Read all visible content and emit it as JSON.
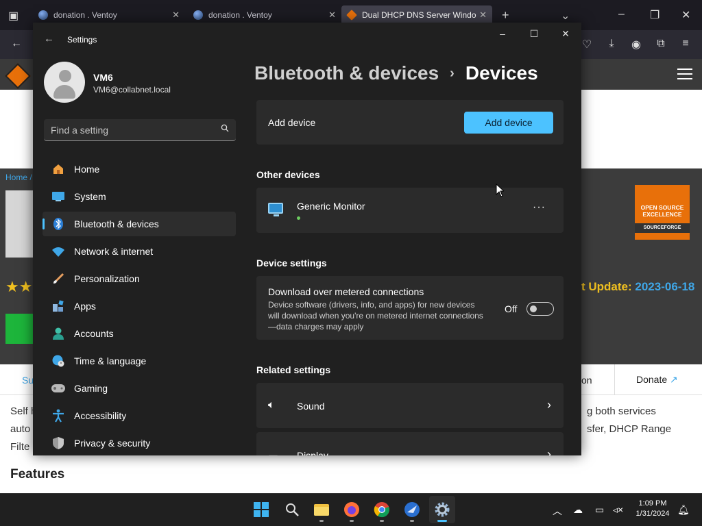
{
  "browser": {
    "tabs": [
      {
        "title": "donation . Ventoy"
      },
      {
        "title": "donation . Ventoy"
      },
      {
        "title": "Dual DHCP DNS Server Windo"
      }
    ],
    "new_tab_symbol": "+"
  },
  "webpage": {
    "breadcrumb": "Home /",
    "badge": {
      "line1": "OPEN SOURCE",
      "line2": "EXCELLENCE",
      "line3": "SOURCEFORGE"
    },
    "last_update_label": "t Update: ",
    "last_update_date": "2023-06-18",
    "tab_left": "Su",
    "tab_mid": "on",
    "donate": "Donate",
    "para_left": [
      "Self h",
      "auto",
      "Filte"
    ],
    "para_right": [
      "g both services",
      "sfer, DHCP Range"
    ],
    "features": "Features"
  },
  "settings": {
    "window_title": "Settings",
    "user": {
      "name": "VM6",
      "email": "VM6@collabnet.local"
    },
    "search_placeholder": "Find a setting",
    "nav": [
      {
        "label": "Home",
        "icon": "home-icon"
      },
      {
        "label": "System",
        "icon": "system-icon"
      },
      {
        "label": "Bluetooth & devices",
        "icon": "bluetooth-icon",
        "selected": true
      },
      {
        "label": "Network & internet",
        "icon": "wifi-icon"
      },
      {
        "label": "Personalization",
        "icon": "brush-icon"
      },
      {
        "label": "Apps",
        "icon": "apps-icon"
      },
      {
        "label": "Accounts",
        "icon": "accounts-icon"
      },
      {
        "label": "Time & language",
        "icon": "globe-clock-icon"
      },
      {
        "label": "Gaming",
        "icon": "gamepad-icon"
      },
      {
        "label": "Accessibility",
        "icon": "accessibility-icon"
      },
      {
        "label": "Privacy & security",
        "icon": "shield-icon"
      }
    ],
    "breadcrumb_parent": "Bluetooth & devices",
    "breadcrumb_sep": "›",
    "breadcrumb_current": "Devices",
    "add_device": {
      "label": "Add device",
      "button": "Add device"
    },
    "other_devices_heading": "Other devices",
    "device": {
      "name": "Generic Monitor",
      "more": "···"
    },
    "device_settings_heading": "Device settings",
    "metered": {
      "title": "Download over metered connections",
      "description": "Device software (drivers, info, and apps) for new devices will download when you're on metered internet connections—data charges may apply",
      "state_label": "Off",
      "enabled": false
    },
    "related_heading": "Related settings",
    "related": [
      {
        "label": "Sound"
      },
      {
        "label": "Display"
      }
    ]
  },
  "taskbar": {
    "time": "1:09 PM",
    "date": "1/31/2024"
  },
  "colors": {
    "accent": "#4cc2ff",
    "window_bg": "#202020",
    "card_bg": "#2b2b2b",
    "brand_orange": "#e8700a"
  }
}
